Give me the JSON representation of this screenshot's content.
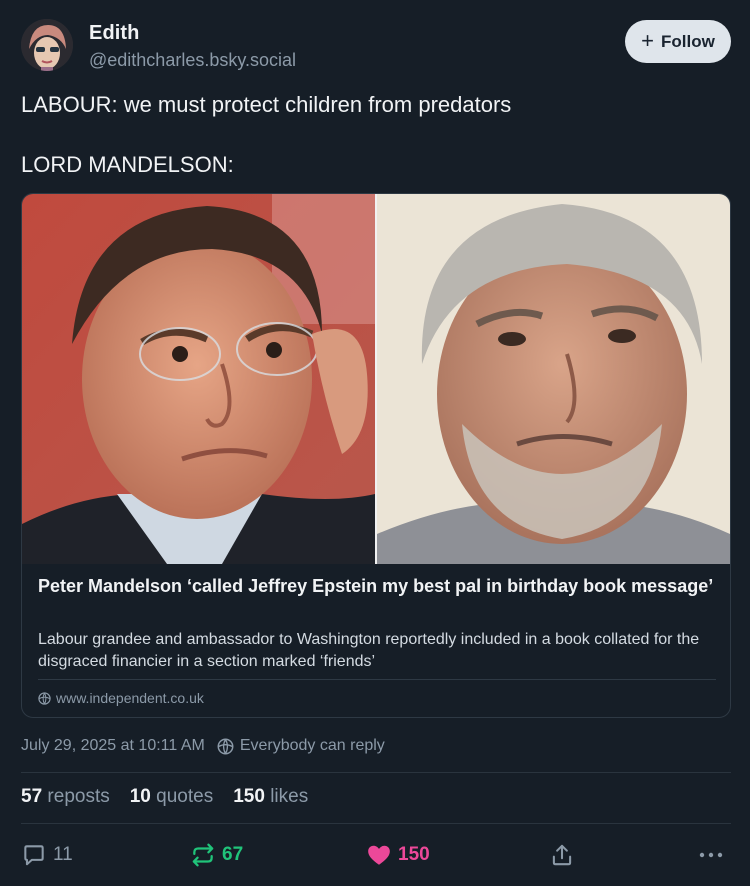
{
  "author": {
    "display_name": "Edith",
    "handle": "@edithcharles.bsky.social"
  },
  "follow_button": {
    "label": "Follow",
    "icon": "plus-icon"
  },
  "post": {
    "lines": [
      "LABOUR: we must protect children from predators",
      "LORD MANDELSON:"
    ]
  },
  "link_card": {
    "title": "Peter Mandelson ‘called Jeffrey Epstein my best pal in birthday book message’",
    "description": "Labour grandee and ambassador to Washington reportedly included in a book collated for the disgraced financier in a section marked ‘friends’",
    "domain": "www.independent.co.uk",
    "domain_icon": "globe-icon"
  },
  "meta": {
    "timestamp": "July 29, 2025 at 10:11 AM",
    "reply_setting": "Everybody can reply",
    "reply_setting_icon": "globe-icon"
  },
  "stats": {
    "reposts_count": "57",
    "reposts_label": "reposts",
    "quotes_count": "10",
    "quotes_label": "quotes",
    "likes_count": "150",
    "likes_label": "likes"
  },
  "actions": {
    "reply_count": "11",
    "repost_count": "67",
    "like_count": "150"
  },
  "colors": {
    "background": "#161e27",
    "follow_button": "#dfe5eb",
    "repost_active": "#20c47a",
    "like_active": "#ec4899",
    "muted_text": "#8c9aa8"
  }
}
